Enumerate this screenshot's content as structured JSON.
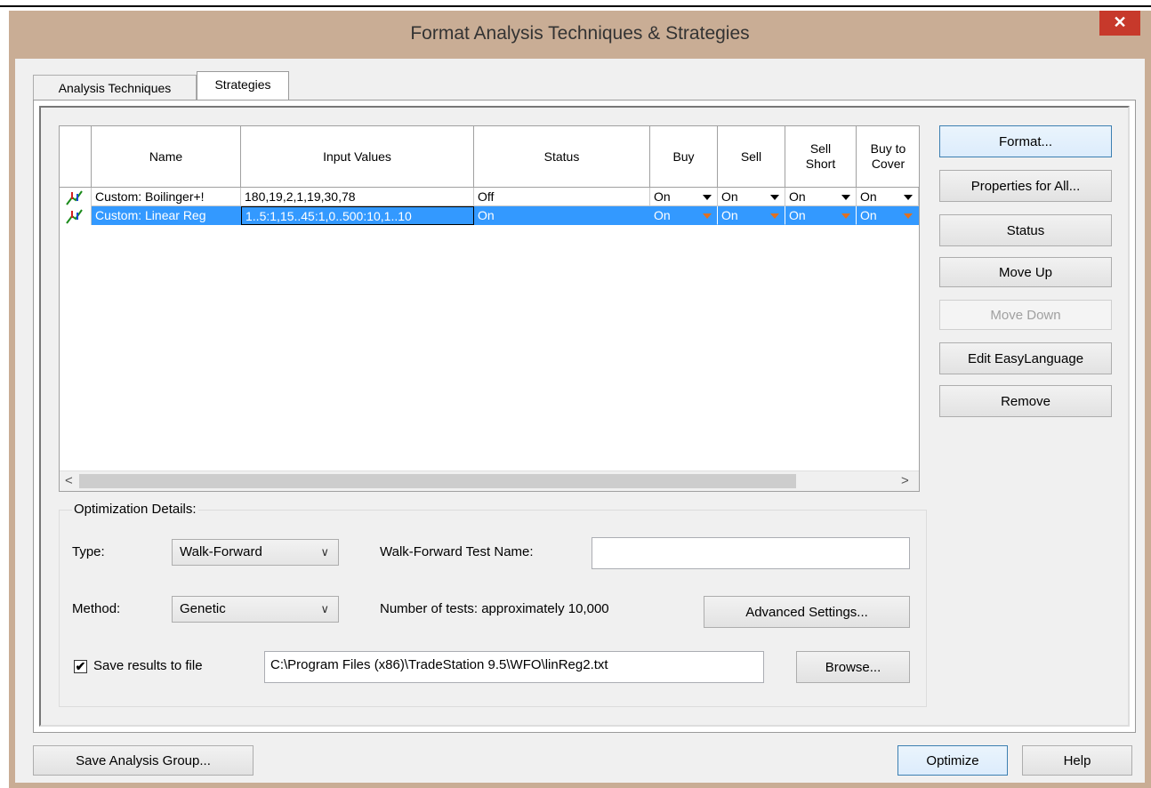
{
  "window": {
    "title": "Format Analysis Techniques & Strategies",
    "close_glyph": "✕"
  },
  "tabs": [
    {
      "label": "Analysis Techniques",
      "active": false
    },
    {
      "label": "Strategies",
      "active": true
    }
  ],
  "grid": {
    "columns": [
      "Name",
      "Input Values",
      "Status",
      "Buy",
      "Sell",
      "Sell Short",
      "Buy to Cover"
    ],
    "rows": [
      {
        "name": "Custom: Boilinger+!",
        "inputs": "180,19,2,1,19,30,78",
        "status": "Off",
        "buy": "On",
        "sell": "On",
        "sell_short": "On",
        "buy_to_cover": "On",
        "selected": false,
        "icon": "strategy-icon"
      },
      {
        "name": "Custom: Linear Reg",
        "inputs": "1..5:1,15..45:1,0..500:10,1..10",
        "status": "On",
        "buy": "On",
        "sell": "On",
        "sell_short": "On",
        "buy_to_cover": "On",
        "selected": true,
        "icon": "strategy-icon"
      }
    ],
    "scroll_left": "<",
    "scroll_right": ">"
  },
  "side_buttons": {
    "format": "Format...",
    "properties_for_all": "Properties for All...",
    "status": "Status",
    "move_up": "Move Up",
    "move_down": "Move Down",
    "edit_easylanguage": "Edit EasyLanguage",
    "remove": "Remove"
  },
  "optimization": {
    "group_label": "Optimization Details:",
    "type_label": "Type:",
    "type_value": "Walk-Forward",
    "wf_test_name_label": "Walk-Forward Test Name:",
    "wf_test_name_value": "",
    "method_label": "Method:",
    "method_value": "Genetic",
    "num_tests": "Number of tests: approximately 10,000",
    "advanced_settings": "Advanced Settings...",
    "save_results_label": "Save results to file",
    "save_results_checked": true,
    "file_path": "C:\\Program Files (x86)\\TradeStation 9.5\\WFO\\linReg2.txt",
    "browse": "Browse..."
  },
  "footer": {
    "save_group": "Save Analysis Group...",
    "optimize": "Optimize",
    "help": "Help"
  },
  "colors": {
    "titlebar": "#c9ad95",
    "close": "#c7392b",
    "selection": "#3399ff"
  }
}
